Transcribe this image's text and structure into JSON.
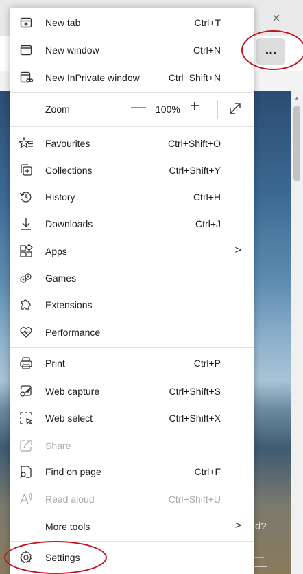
{
  "browser": {
    "close_tab_glyph": "×",
    "more_button_glyph": "...",
    "page_fragment_text": "d?",
    "page_fragment_box": "—"
  },
  "menu": {
    "items_top": [
      {
        "icon": "new-tab-icon",
        "label": "New tab",
        "shortcut": "Ctrl+T"
      },
      {
        "icon": "new-window-icon",
        "label": "New window",
        "shortcut": "Ctrl+N"
      },
      {
        "icon": "inprivate-window-icon",
        "label": "New InPrivate window",
        "shortcut": "Ctrl+Shift+N"
      }
    ],
    "zoom": {
      "label": "Zoom",
      "minus": "—",
      "value": "100%",
      "plus": "+",
      "expand_icon": "full-screen-icon"
    },
    "items_middle": [
      {
        "icon": "favourites-icon",
        "label": "Favourites",
        "shortcut": "Ctrl+Shift+O"
      },
      {
        "icon": "collections-icon",
        "label": "Collections",
        "shortcut": "Ctrl+Shift+Y"
      },
      {
        "icon": "history-icon",
        "label": "History",
        "shortcut": "Ctrl+H"
      },
      {
        "icon": "downloads-icon",
        "label": "Downloads",
        "shortcut": "Ctrl+J"
      },
      {
        "icon": "apps-icon",
        "label": "Apps",
        "submenu": ">"
      },
      {
        "icon": "games-icon",
        "label": "Games"
      },
      {
        "icon": "extensions-icon",
        "label": "Extensions"
      },
      {
        "icon": "performance-icon",
        "label": "Performance"
      }
    ],
    "items_bottom": [
      {
        "icon": "print-icon",
        "label": "Print",
        "shortcut": "Ctrl+P"
      },
      {
        "icon": "web-capture-icon",
        "label": "Web capture",
        "shortcut": "Ctrl+Shift+S"
      },
      {
        "icon": "web-select-icon",
        "label": "Web select",
        "shortcut": "Ctrl+Shift+X"
      },
      {
        "icon": "share-icon",
        "label": "Share",
        "disabled": true
      },
      {
        "icon": "find-on-page-icon",
        "label": "Find on page",
        "shortcut": "Ctrl+F"
      },
      {
        "icon": "read-aloud-icon",
        "label": "Read aloud",
        "shortcut": "Ctrl+Shift+U",
        "disabled": true
      },
      {
        "label": "More tools",
        "submenu": ">"
      }
    ],
    "settings": {
      "icon": "settings-icon",
      "label": "Settings"
    }
  },
  "colors": {
    "annotation": "#c0141e",
    "disabled_text": "#a8a8a8",
    "menu_background": "#ffffff"
  }
}
